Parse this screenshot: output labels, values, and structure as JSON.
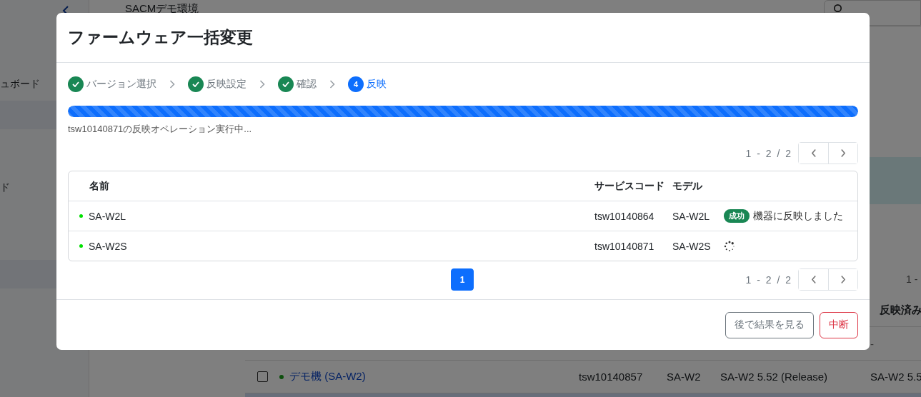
{
  "app": {
    "title": "SACMデモ環境",
    "sidebar": {
      "items": [
        {
          "label": "ュボード",
          "selected": false
        },
        {
          "selected": true
        },
        {
          "label": "ド",
          "selected": false
        },
        {
          "selected": true
        }
      ]
    },
    "pager_text": "1 -",
    "table": {
      "columns": [
        "反映済み"
      ],
      "rows": [
        {
          "kind": "dash",
          "text": "-",
          "selected": false
        },
        {
          "kind": "device",
          "checked": false,
          "selected": false,
          "name": "デモ機 (SA-W2)",
          "cells": [
            "tsw10140857",
            "SA-W2",
            "SA-W2 5.52 (Release)",
            "SA-W2 5.5"
          ]
        },
        {
          "kind": "blank",
          "selected": true
        }
      ]
    }
  },
  "modal": {
    "title": "ファームウェア一括変更",
    "steps": [
      {
        "label": "バージョン選択",
        "done": true,
        "selected": false
      },
      {
        "label": "反映設定",
        "done": true,
        "selected": false
      },
      {
        "label": "確認",
        "done": true,
        "selected": false
      },
      {
        "number": "4",
        "label": "反映",
        "done": false,
        "selected": true
      }
    ],
    "progress": {
      "level": 1
    },
    "status_text": "tsw10140871の反映オペレーション実行中...",
    "pager_top": "1 - 2 / 2",
    "table": {
      "columns": [
        "名前",
        "サービスコード",
        "モデル"
      ],
      "rows": [
        {
          "name": "SA-W2L",
          "service_code": "tsw10140864",
          "model": "SA-W2L",
          "result": {
            "kind": "success",
            "badge": "成功",
            "message": "機器に反映しました"
          }
        },
        {
          "name": "SA-W2S",
          "service_code": "tsw10140871",
          "model": "SA-W2S",
          "result": {
            "kind": "loading"
          }
        }
      ]
    },
    "pages": [
      {
        "label": "1",
        "selected": true
      }
    ],
    "pager_bottom": "1 - 2 / 2",
    "buttons": [
      {
        "label": "後で結果を見る",
        "kind": "secondary"
      },
      {
        "label": "中断",
        "kind": "danger"
      }
    ]
  }
}
